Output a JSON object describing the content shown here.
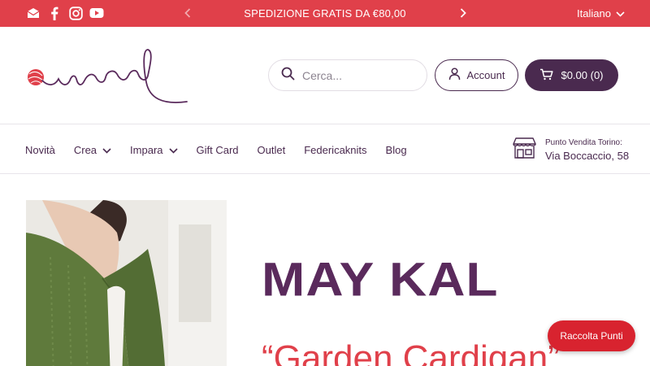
{
  "announcement": {
    "social_icons": [
      "email-icon",
      "facebook-icon",
      "instagram-icon",
      "youtube-icon"
    ],
    "text": "SPEDIZIONE GRATIS DA €80,00",
    "language": "Italiano",
    "background": "#e0404a"
  },
  "header": {
    "search_placeholder": "Cerca...",
    "account_label": "Account",
    "cart_label": "$0.00 (0)",
    "brand_color": "#4a2a4f"
  },
  "nav": {
    "items": [
      {
        "label": "Novità"
      },
      {
        "label": "Crea"
      },
      {
        "label": "Impara"
      },
      {
        "label": "Gift Card"
      },
      {
        "label": "Outlet"
      },
      {
        "label": "Federicaknits"
      },
      {
        "label": "Blog"
      }
    ],
    "store_caption": "Punto Vendita Torino:",
    "store_address": "Via Boccaccio, 58"
  },
  "hero": {
    "title": "MAY KAL",
    "subtitle": "“Garden Cardigan”"
  },
  "rewards_button": "Raccolta Punti"
}
